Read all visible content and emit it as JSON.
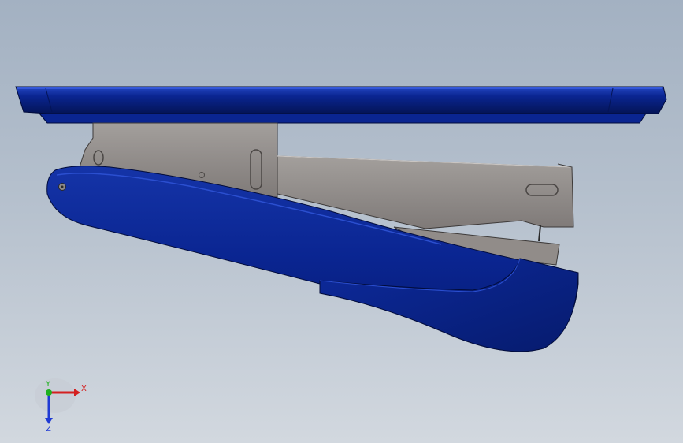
{
  "viewport": {
    "background_top": "#a3b1c2",
    "background_bottom": "#d2d8df"
  },
  "model": {
    "part_color_primary": "#0a2591",
    "part_color_dark": "#061b6e",
    "part_color_highlight": "#2b4fd0",
    "metal_color": "#8e8987",
    "metal_edge": "#3d3a39"
  },
  "triad": {
    "x_label": "X",
    "y_label": "Y",
    "z_label": "Z",
    "x_color": "#d42020",
    "y_color": "#1fb01f",
    "z_color": "#1f3ad4"
  }
}
